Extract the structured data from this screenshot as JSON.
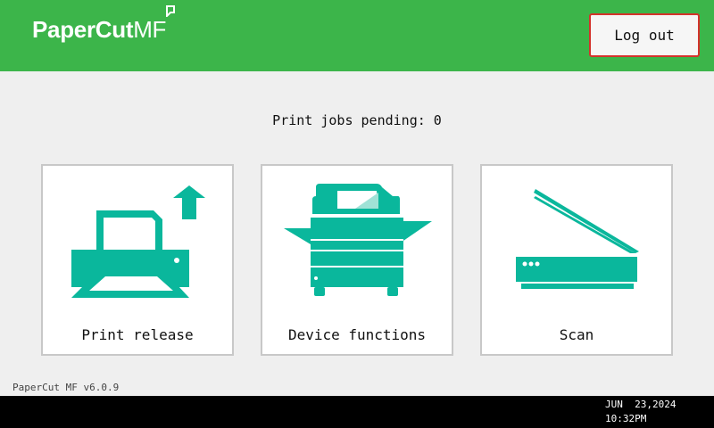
{
  "header": {
    "brand_name": "PaperCut",
    "brand_suffix": "MF",
    "logout_label": "Log out",
    "color": "#3cb54a"
  },
  "main": {
    "pending_text": "Print jobs pending: 0",
    "tiles": [
      {
        "label": "Print release",
        "icon": "printer-release-icon"
      },
      {
        "label": "Device functions",
        "icon": "copier-icon"
      },
      {
        "label": "Scan",
        "icon": "scanner-icon"
      }
    ],
    "icon_color": "#0ab79c"
  },
  "footer": {
    "version": "PaperCut MF v6.0.9"
  },
  "status_bar": {
    "date": "JUN  23,2024",
    "time": "10:32PM"
  }
}
